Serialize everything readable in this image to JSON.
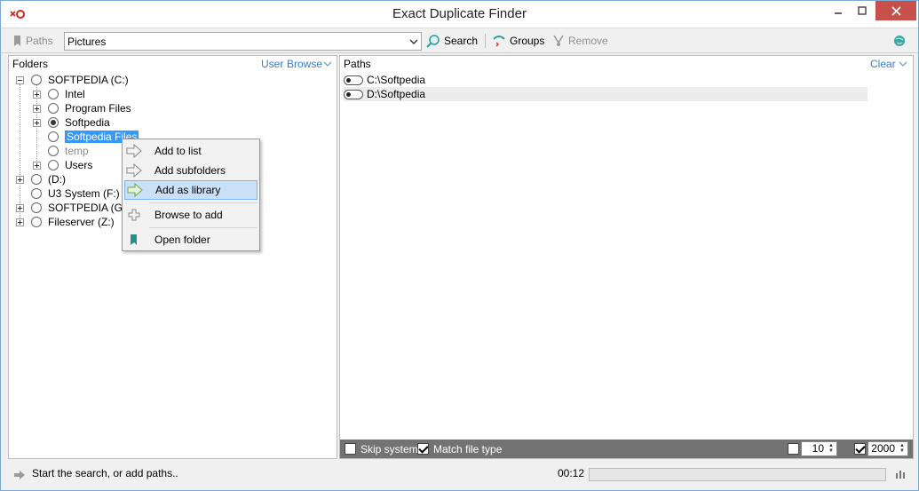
{
  "window": {
    "title": "Exact Duplicate Finder"
  },
  "toolbar": {
    "paths_label": "Paths",
    "paths_value": "Pictures",
    "search_label": "Search",
    "groups_label": "Groups",
    "remove_label": "Remove"
  },
  "folders": {
    "header": "Folders",
    "user_link": "User",
    "browse_link": "Browse",
    "tree": [
      {
        "label": "SOFTPEDIA (C:)"
      },
      {
        "label": "Intel"
      },
      {
        "label": "Program Files"
      },
      {
        "label": "Softpedia"
      },
      {
        "label": "Softpedia Files"
      },
      {
        "label": "temp"
      },
      {
        "label": "Users"
      },
      {
        "label": "(D:)"
      },
      {
        "label": "U3 System (F:)"
      },
      {
        "label": "SOFTPEDIA (G:)"
      },
      {
        "label": "Fileserver (Z:)"
      }
    ]
  },
  "context_menu": {
    "items": [
      {
        "label": "Add to list"
      },
      {
        "label": "Add subfolders"
      },
      {
        "label": "Add as library"
      },
      {
        "label": "Browse to add"
      },
      {
        "label": "Open folder"
      }
    ]
  },
  "paths_panel": {
    "header": "Paths",
    "clear_link": "Clear",
    "items": [
      {
        "label": "C:\\Softpedia"
      },
      {
        "label": "D:\\Softpedia"
      }
    ]
  },
  "options": {
    "skip_system_label": "Skip system",
    "skip_system_checked": false,
    "match_file_type_label": "Match file type",
    "match_file_type_checked": true,
    "min_enabled": false,
    "min_value": "10",
    "max_enabled": true,
    "max_value": "2000"
  },
  "status": {
    "message": "Start the search, or add paths..",
    "elapsed": "00:12",
    "progress": 0
  },
  "colors": {
    "selection": "#3399ff",
    "link": "#3a7bd5",
    "close_button": "#c7504a",
    "options_bar": "#737373"
  }
}
